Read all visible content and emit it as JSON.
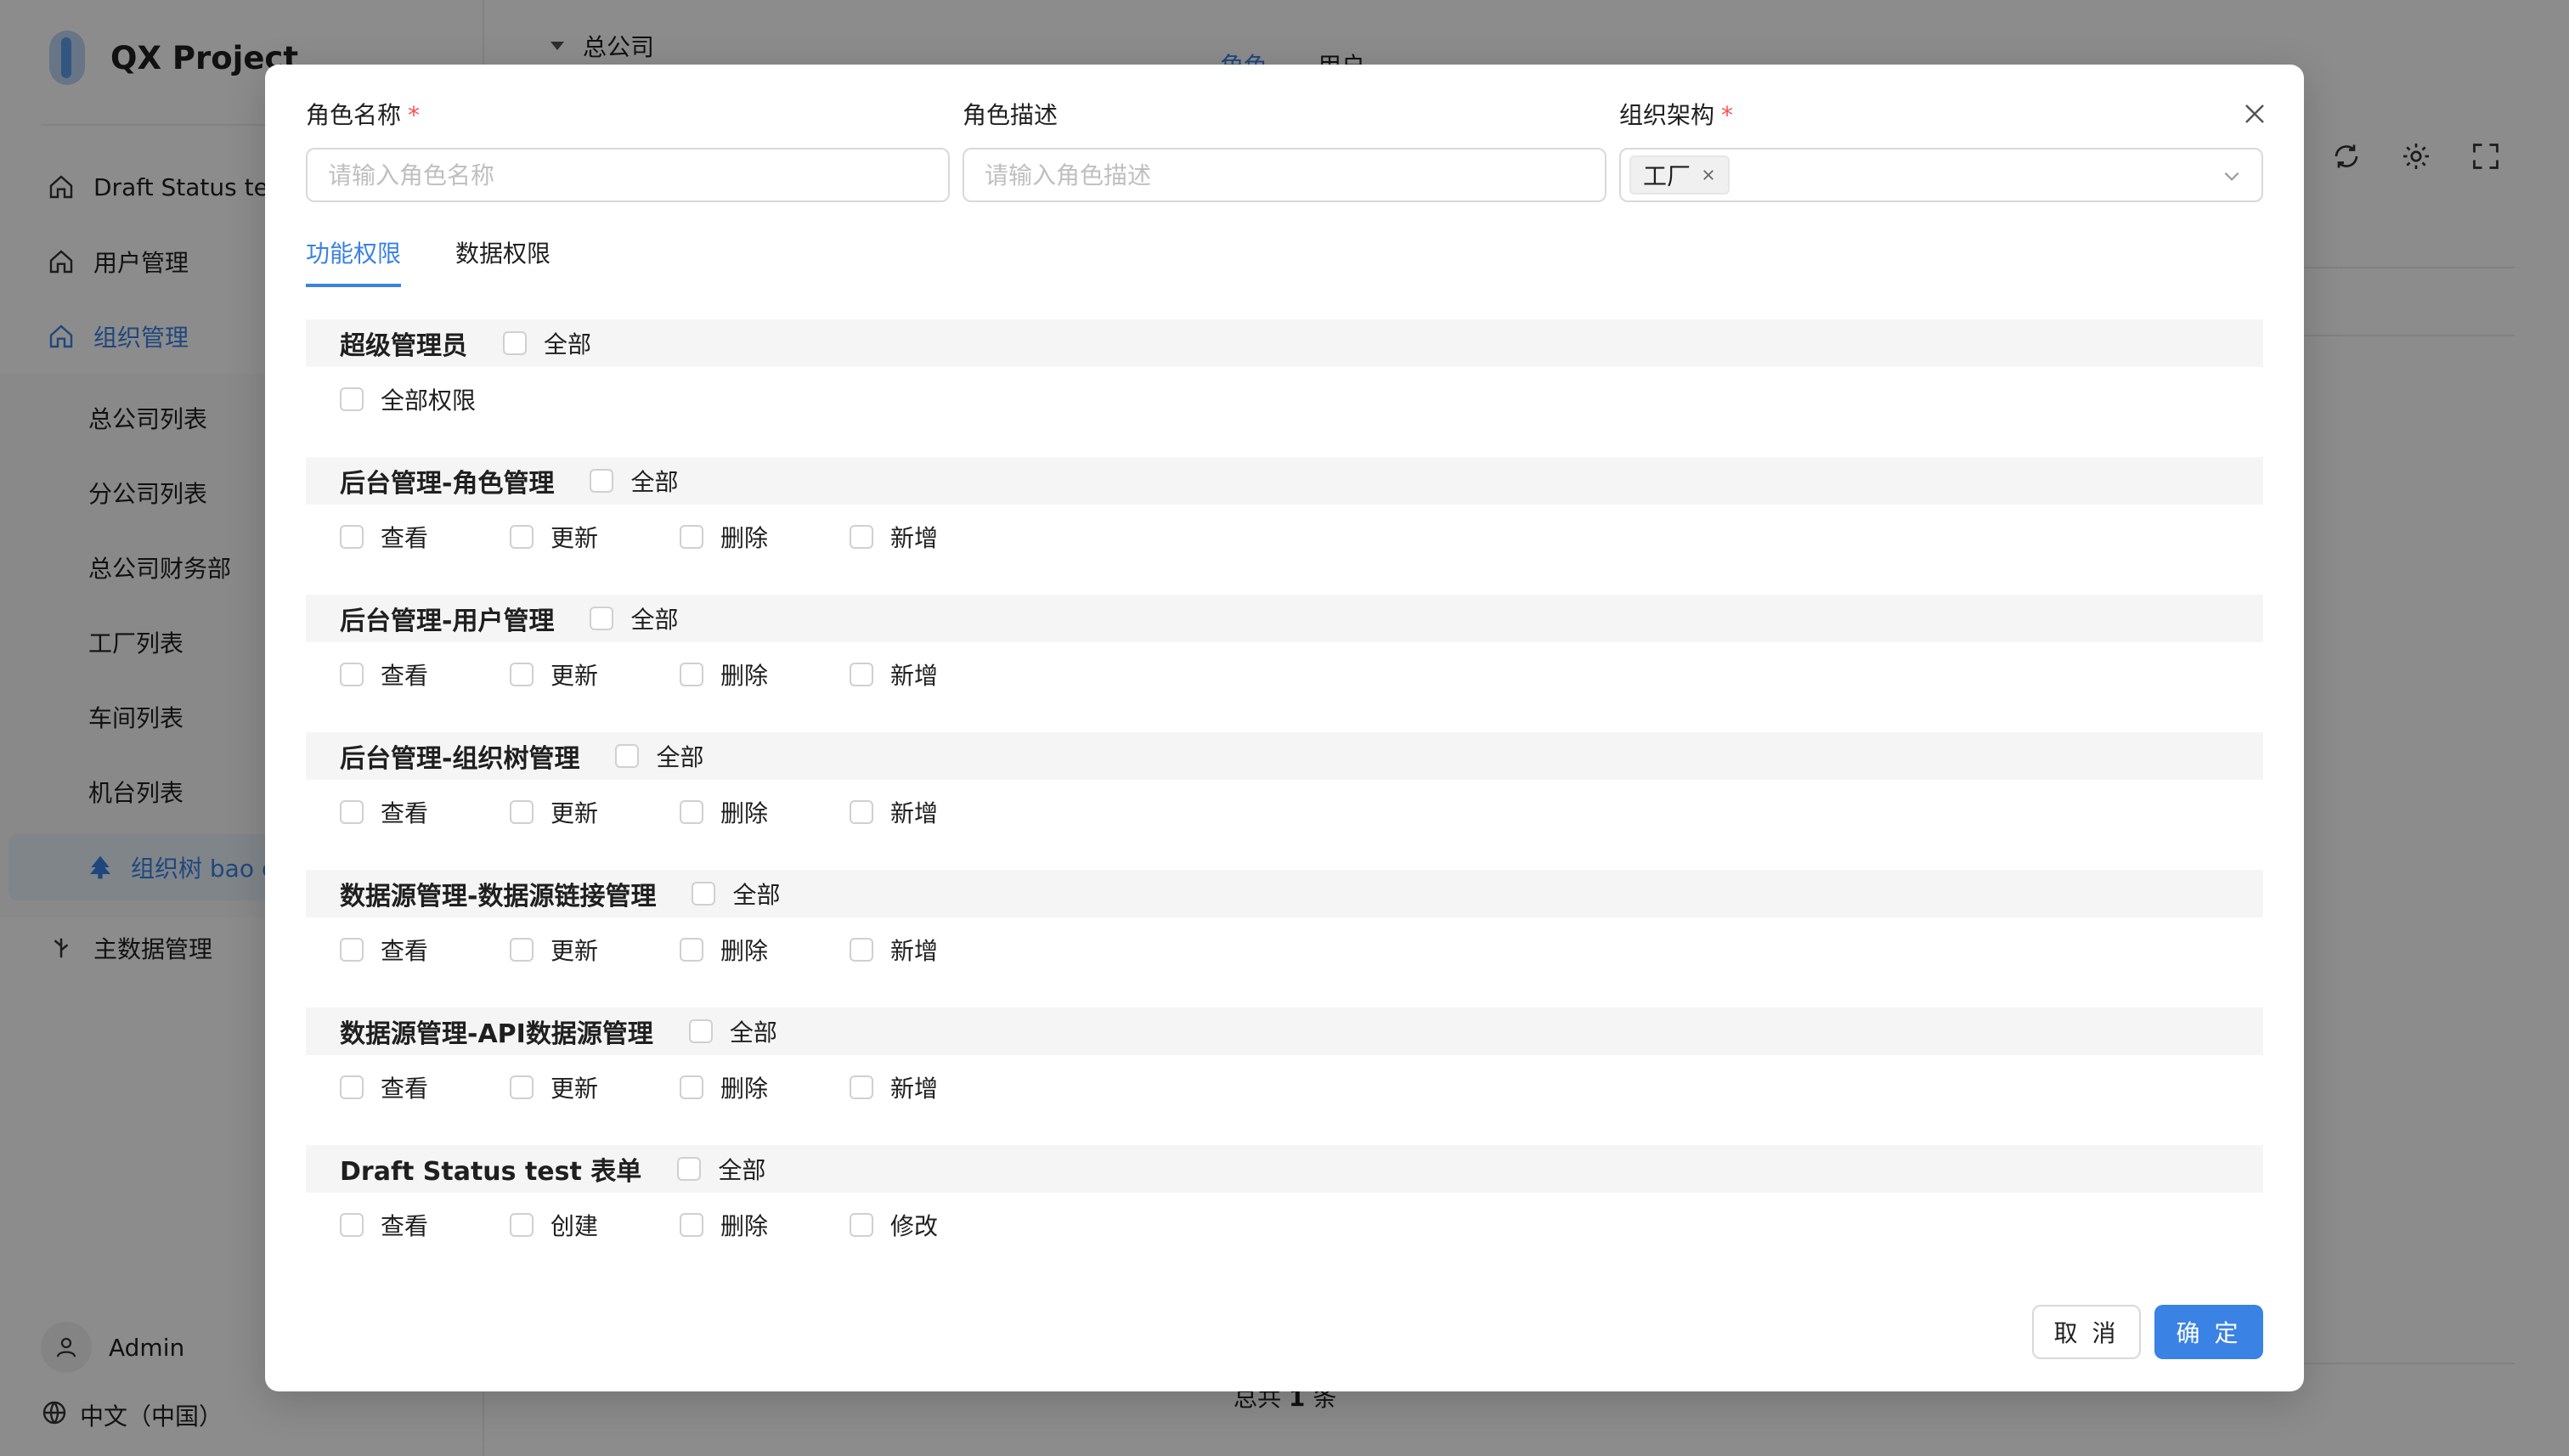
{
  "app": {
    "title": "QX Project"
  },
  "sidebar": {
    "items": [
      {
        "label": "Draft Status tes",
        "icon": "home-icon"
      },
      {
        "label": "用户管理",
        "icon": "home-icon"
      },
      {
        "label": "组织管理",
        "icon": "home-icon"
      }
    ],
    "sub_items": [
      "总公司列表",
      "分公司列表",
      "总公司财务部",
      "工厂列表",
      "车间列表",
      "机台列表"
    ],
    "active_sub_item": "组织树 bao c",
    "master_data": "主数据管理",
    "user": "Admin",
    "language": "中文（中国）"
  },
  "main": {
    "tree_root": "总公司",
    "tabs": [
      "角色",
      "用户"
    ],
    "total_prefix": "总共",
    "total_count": "1",
    "total_suffix": "条"
  },
  "modal": {
    "fields": {
      "role_name": {
        "label": "角色名称",
        "placeholder": "请输入角色名称",
        "required": "*"
      },
      "role_desc": {
        "label": "角色描述",
        "placeholder": "请输入角色描述"
      },
      "org": {
        "label": "组织架构",
        "required": "*",
        "selected_tag": "工厂"
      }
    },
    "tabs": [
      "功能权限",
      "数据权限"
    ],
    "all_label": "全部",
    "groups": [
      {
        "title": "超级管理员",
        "perms": [
          "全部权限"
        ]
      },
      {
        "title": "后台管理-角色管理",
        "perms": [
          "查看",
          "更新",
          "删除",
          "新增"
        ]
      },
      {
        "title": "后台管理-用户管理",
        "perms": [
          "查看",
          "更新",
          "删除",
          "新增"
        ]
      },
      {
        "title": "后台管理-组织树管理",
        "perms": [
          "查看",
          "更新",
          "删除",
          "新增"
        ]
      },
      {
        "title": "数据源管理-数据源链接管理",
        "perms": [
          "查看",
          "更新",
          "删除",
          "新增"
        ]
      },
      {
        "title": "数据源管理-API数据源管理",
        "perms": [
          "查看",
          "更新",
          "删除",
          "新增"
        ]
      },
      {
        "title": "Draft Status test 表单",
        "perms": [
          "查看",
          "创建",
          "删除",
          "修改"
        ]
      }
    ],
    "buttons": {
      "cancel": "取 消",
      "ok": "确 定"
    }
  },
  "colors": {
    "accent": "#3a82e3",
    "required": "#ff4d4f"
  }
}
